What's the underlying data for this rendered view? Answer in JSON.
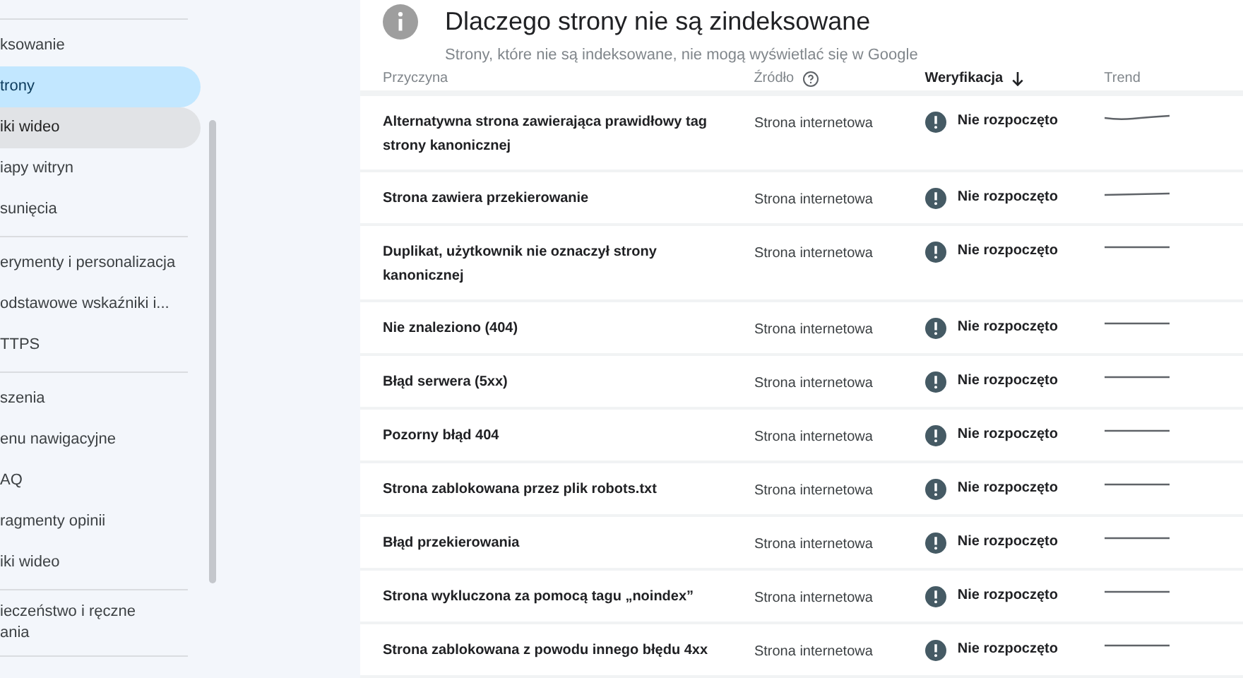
{
  "sidebar": {
    "groups": [
      {
        "items": [
          {
            "label": "ksowanie",
            "selected": false,
            "hovered": false
          },
          {
            "label": "trony",
            "selected": true,
            "hovered": false
          },
          {
            "label": "iki wideo",
            "selected": false,
            "hovered": true
          },
          {
            "label": "iapy witryn",
            "selected": false,
            "hovered": false
          },
          {
            "label": "sunięcia",
            "selected": false,
            "hovered": false
          }
        ]
      },
      {
        "items": [
          {
            "label": "erymenty i personalizacja",
            "selected": false,
            "hovered": false
          },
          {
            "label": "odstawowe wskaźniki i...",
            "selected": false,
            "hovered": false
          },
          {
            "label": "TTPS",
            "selected": false,
            "hovered": false
          }
        ]
      },
      {
        "items": [
          {
            "label": "szenia",
            "selected": false,
            "hovered": false
          },
          {
            "label": "enu nawigacyjne",
            "selected": false,
            "hovered": false
          },
          {
            "label": "AQ",
            "selected": false,
            "hovered": false
          },
          {
            "label": "ragmenty opinii",
            "selected": false,
            "hovered": false
          },
          {
            "label": "iki wideo",
            "selected": false,
            "hovered": false
          }
        ]
      },
      {
        "items": [
          {
            "label": "ieczeństwo i ręczne\nania",
            "selected": false,
            "hovered": false
          }
        ]
      }
    ]
  },
  "card": {
    "title": "Dlaczego strony nie są zindeksowane",
    "subtitle": "Strony, które nie są indeksowane, nie mogą wyświetlać się w Google"
  },
  "table": {
    "columns": [
      {
        "label": "Przyczyna",
        "sorted": false,
        "help": false
      },
      {
        "label": "Źródło",
        "sorted": false,
        "help": true
      },
      {
        "label": "Weryfikacja",
        "sorted": true,
        "help": false
      },
      {
        "label": "Trend",
        "sorted": false,
        "help": false
      }
    ],
    "rows": [
      {
        "reason": "Alternatywna strona zawierająca prawidłowy tag strony kanonicznej",
        "source": "Strona internetowa",
        "status": "Nie rozpoczęto"
      },
      {
        "reason": "Strona zawiera przekierowanie",
        "source": "Strona internetowa",
        "status": "Nie rozpoczęto"
      },
      {
        "reason": "Duplikat, użytkownik nie oznaczył strony kanonicznej",
        "source": "Strona internetowa",
        "status": "Nie rozpoczęto"
      },
      {
        "reason": "Nie znaleziono (404)",
        "source": "Strona internetowa",
        "status": "Nie rozpoczęto"
      },
      {
        "reason": "Błąd serwera (5xx)",
        "source": "Strona internetowa",
        "status": "Nie rozpoczęto"
      },
      {
        "reason": "Pozorny błąd 404",
        "source": "Strona internetowa",
        "status": "Nie rozpoczęto"
      },
      {
        "reason": "Strona zablokowana przez plik robots.txt",
        "source": "Strona internetowa",
        "status": "Nie rozpoczęto"
      },
      {
        "reason": "Błąd przekierowania",
        "source": "Strona internetowa",
        "status": "Nie rozpoczęto"
      },
      {
        "reason": "Strona wykluczona za pomocą tagu „noindex”",
        "source": "Strona internetowa",
        "status": "Nie rozpoczęto"
      },
      {
        "reason": "Strona zablokowana z powodu innego błędu 4xx",
        "source": "Strona internetowa",
        "status": "Nie rozpoczęto"
      }
    ]
  }
}
